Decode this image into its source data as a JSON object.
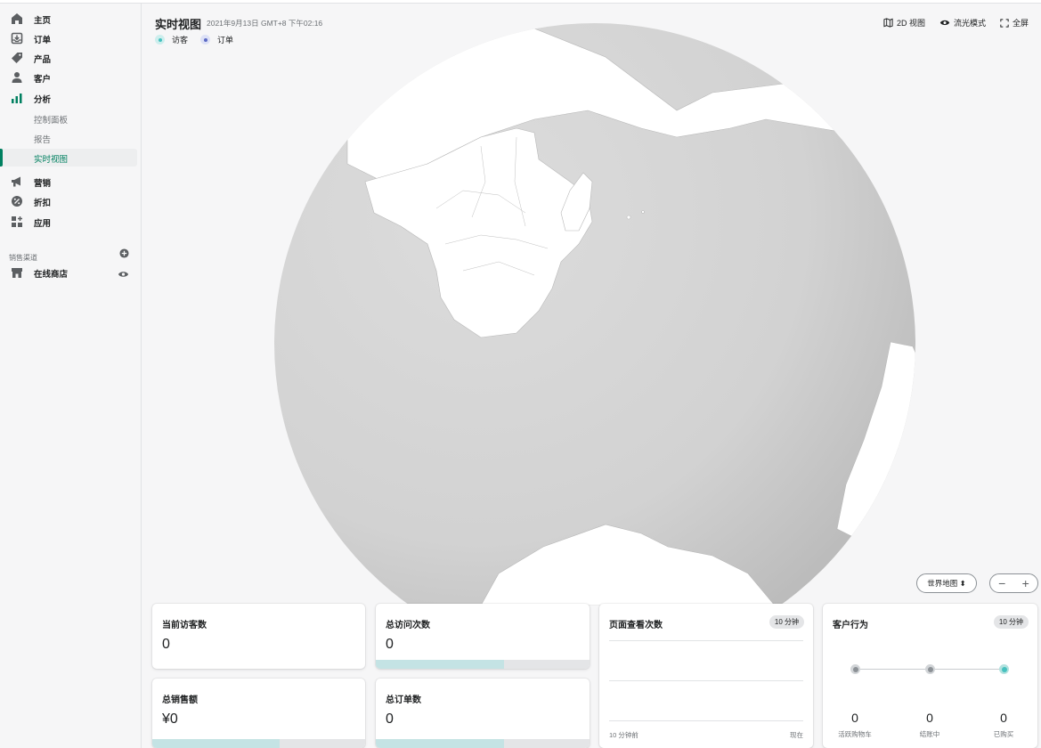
{
  "sidebar": {
    "items": [
      {
        "label": "主页",
        "icon": "home-icon"
      },
      {
        "label": "订单",
        "icon": "orders-icon"
      },
      {
        "label": "产品",
        "icon": "tag-icon"
      },
      {
        "label": "客户",
        "icon": "person-icon"
      },
      {
        "label": "分析",
        "icon": "analytics-icon"
      }
    ],
    "analytics_sub": [
      {
        "label": "控制面板"
      },
      {
        "label": "报告"
      },
      {
        "label": "实时视图"
      }
    ],
    "items2": [
      {
        "label": "营销",
        "icon": "megaphone-icon"
      },
      {
        "label": "折扣",
        "icon": "discount-icon"
      },
      {
        "label": "应用",
        "icon": "apps-icon"
      }
    ],
    "channels_label": "销售渠道",
    "online_store": "在线商店"
  },
  "header": {
    "title": "实时视图",
    "date": "2021年9月13日 GMT+8 下午02:16",
    "legend_visitors": "访客",
    "legend_orders": "订单",
    "btn_2d": "2D 视图",
    "btn_stream": "流光模式",
    "btn_fullscreen": "全屏"
  },
  "map": {
    "select_label": "世界地图 ⬍",
    "zoom_out": "−",
    "zoom_in": "+"
  },
  "cards": {
    "current_visitors": {
      "title": "当前访客数",
      "value": "0"
    },
    "total_visits": {
      "title": "总访问次数",
      "value": "0",
      "fill": 0.6
    },
    "total_sales": {
      "title": "总销售额",
      "value": "¥0",
      "fill": 0.6
    },
    "total_orders": {
      "title": "总订单数",
      "value": "0",
      "fill": 0.6
    },
    "page_views": {
      "title": "页面查看次数",
      "badge": "10 分钟",
      "axis_start": "10 分钟前",
      "axis_end": "现在"
    },
    "customer_behavior": {
      "title": "客户行为",
      "badge": "10 分钟",
      "stages": [
        {
          "label": "活跃购物车",
          "value": "0"
        },
        {
          "label": "结账中",
          "value": "0"
        },
        {
          "label": "已购买",
          "value": "0"
        }
      ]
    }
  },
  "colors": {
    "accent": "#008060",
    "visitor_dot": "#47c1bf",
    "order_dot": "#5c6ac4",
    "progress": "#c4e3e4"
  }
}
